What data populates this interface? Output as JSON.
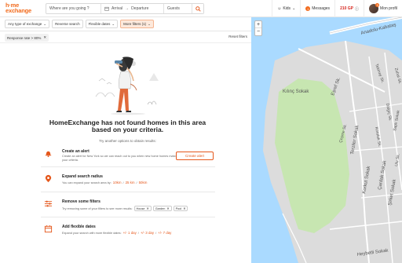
{
  "header": {
    "logo_line1": "h·me",
    "logo_line2": "exchange",
    "where_placeholder": "Where are you going ?",
    "arrival": "Arrival",
    "departure": "Departure",
    "guests": "Guests",
    "kids": "Kids",
    "messages": "Messages",
    "messages_count": "1",
    "guestpoints": "210 GP",
    "profile": "Mon profil",
    "profile_badge": "9"
  },
  "filters": {
    "type_of_exchange": "Any type of exchange",
    "reverse_search": "Reverse search",
    "flexible_dates": "Flexible dates",
    "more_filters": "More filters (1)",
    "chip": "Response rate > 80%",
    "reset": "Reset filters"
  },
  "main": {
    "title": "HomeExchange has not found homes in this area based on your criteria.",
    "subtitle": "Try another options to obtain results:",
    "options": [
      {
        "title": "Create an alert",
        "desc": "Create an alert for New York so we can reach out to you when new home homes matching your criteria.",
        "button": "Create alert"
      },
      {
        "title": "Expand search radius",
        "desc": "You can expand your search area by:",
        "links": [
          "10km",
          "25 km",
          "50km"
        ]
      },
      {
        "title": "Remove some filters",
        "desc": "Try removing some of your filters to see more results:",
        "tags": [
          "House",
          "Garden",
          "Pool"
        ]
      },
      {
        "title": "Add flexible dates",
        "desc": "Expand your search with more flexible dates:",
        "links": [
          "+/- 1 day",
          "+/- 3 day",
          "+/- 7 day"
        ]
      }
    ]
  },
  "map": {
    "zoom_in": "+",
    "zoom_out": "−",
    "labels": [
      "Kılınç Sokak",
      "Tekinay Sk.",
      "Zuhal Sk.",
      "Dalgıç Sk.",
      "Koruluk Sk.",
      "Çeşme Sk.",
      "Eşref Sk.",
      "Terziler Sokak",
      "Saplı Sokak",
      "Korkut Sokak",
      "Çardak Sokak",
      "Şirket Sokak",
      "Heybetli Sokak",
      "Anadolu-Kabataş",
      "Ulu Sk."
    ]
  }
}
